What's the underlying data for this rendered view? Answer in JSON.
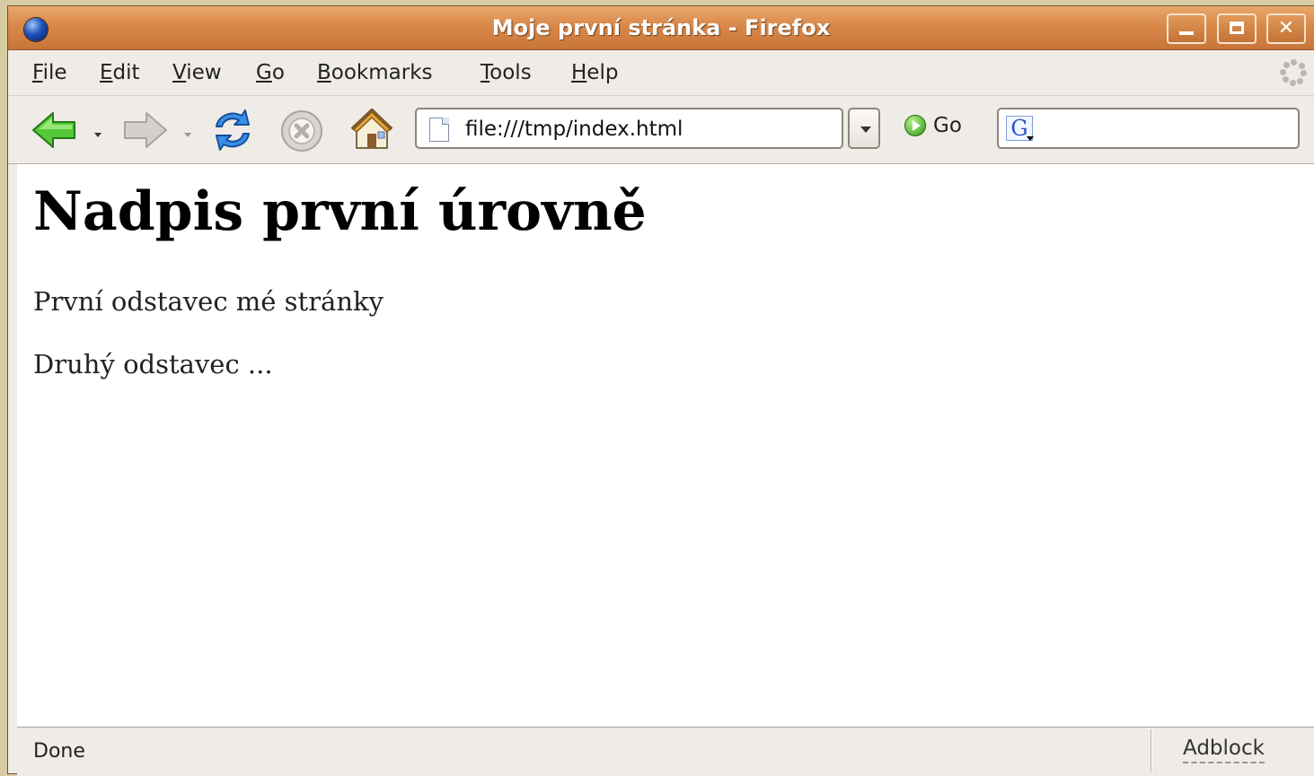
{
  "window": {
    "title": "Moje první stránka - Firefox",
    "buttons": {
      "minimize": "",
      "maximize": "",
      "close": "✕"
    }
  },
  "menubar": {
    "items": [
      {
        "label": "File",
        "mnemonic": "F"
      },
      {
        "label": "Edit",
        "mnemonic": "E"
      },
      {
        "label": "View",
        "mnemonic": "V"
      },
      {
        "label": "Go",
        "mnemonic": "G"
      },
      {
        "label": "Bookmarks",
        "mnemonic": "B"
      },
      {
        "label": "Tools",
        "mnemonic": "T"
      },
      {
        "label": "Help",
        "mnemonic": "H"
      }
    ]
  },
  "navbar": {
    "url": "file:///tmp/index.html",
    "go_label": "Go",
    "search_engine_icon": "G",
    "search_value": ""
  },
  "content": {
    "heading": "Nadpis první úrovně",
    "paragraphs": [
      "První odstavec mé stránky",
      "Druhý odstavec ..."
    ]
  },
  "statusbar": {
    "status": "Done",
    "adblock": "Adblock"
  },
  "colors": {
    "titlebar": "#d9884a",
    "chrome": "#efebe7",
    "back_arrow": "#3fb825",
    "reload": "#2b7fd6",
    "go": "#2e9a12"
  }
}
